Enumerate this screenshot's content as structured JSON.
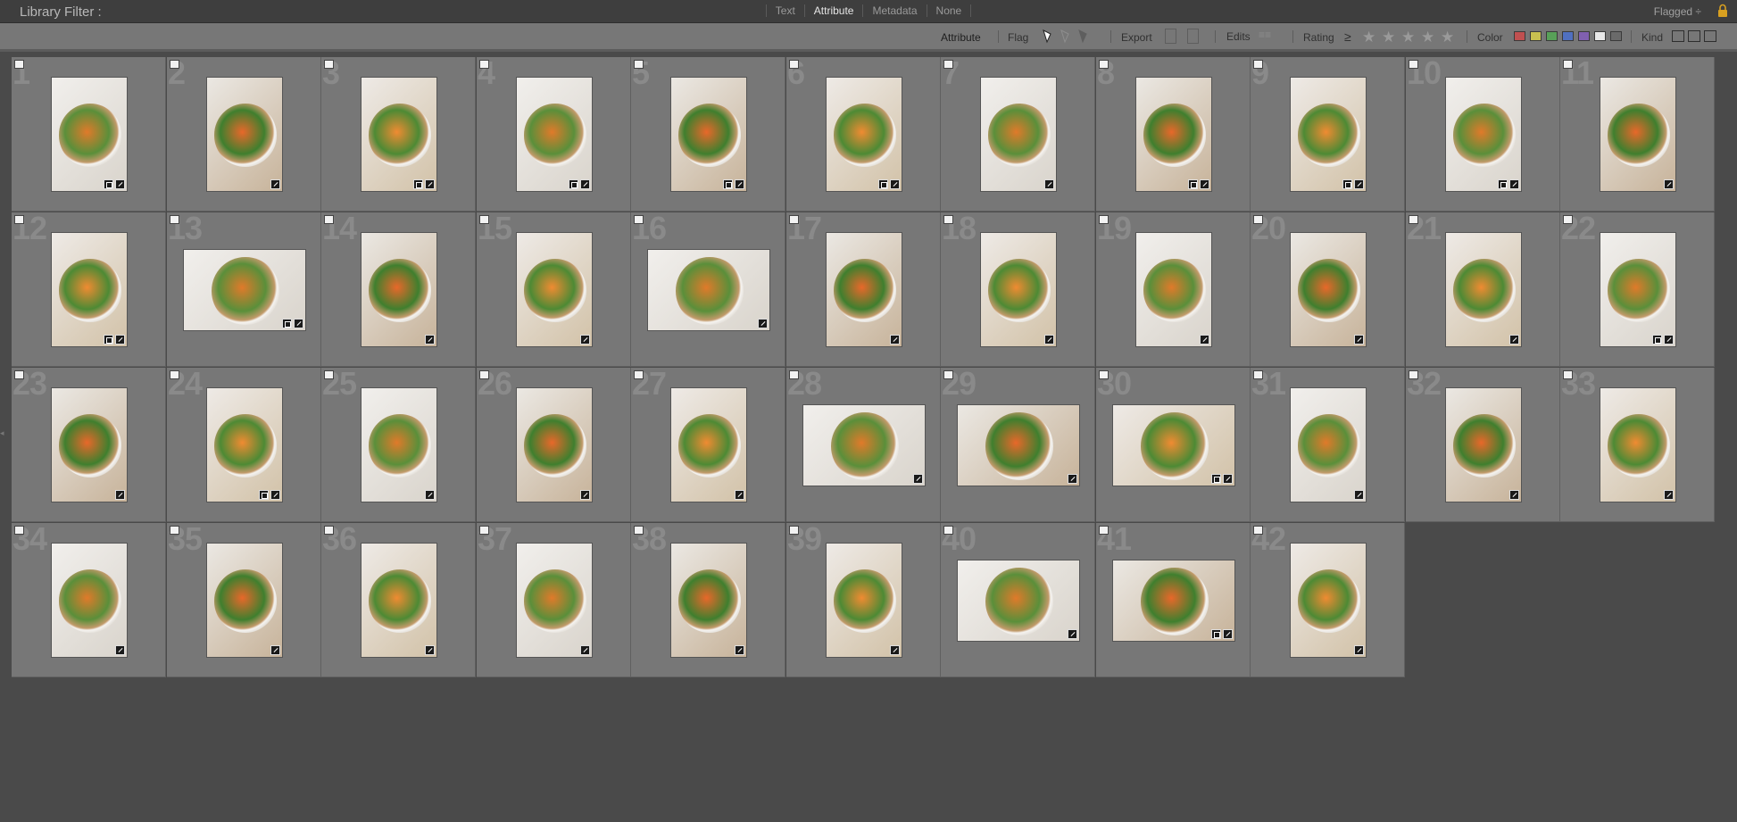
{
  "filter_bar": {
    "title": "Library Filter :",
    "tabs": [
      "Text",
      "Attribute",
      "Metadata",
      "None"
    ],
    "active_tab": "Attribute",
    "preset": "Flagged ÷",
    "lock_icon": "lock-icon"
  },
  "attribute_bar": {
    "label": "Attribute",
    "flag_label": "Flag",
    "export_label": "Export",
    "edits_label": "Edits",
    "rating_label": "Rating",
    "rating_op": "≥",
    "color_label": "Color",
    "kind_label": "Kind",
    "color_swatches": [
      "#c05050",
      "#c8c050",
      "#58a058",
      "#5070c0",
      "#8060b0",
      "#e8e8e8",
      "#6a6a6a"
    ]
  },
  "photos": [
    {
      "n": "1",
      "o": "p",
      "b": 2
    },
    {
      "n": "2",
      "o": "p",
      "b": 1
    },
    {
      "n": "3",
      "o": "p",
      "b": 2
    },
    {
      "n": "4",
      "o": "p",
      "b": 2
    },
    {
      "n": "5",
      "o": "p",
      "b": 2
    },
    {
      "n": "6",
      "o": "p",
      "b": 2
    },
    {
      "n": "7",
      "o": "p",
      "b": 1
    },
    {
      "n": "8",
      "o": "p",
      "b": 2
    },
    {
      "n": "9",
      "o": "p",
      "b": 2
    },
    {
      "n": "10",
      "o": "p",
      "b": 2
    },
    {
      "n": "11",
      "o": "p",
      "b": 1
    },
    {
      "n": "12",
      "o": "p",
      "b": 2
    },
    {
      "n": "13",
      "o": "l",
      "b": 2
    },
    {
      "n": "14",
      "o": "p",
      "b": 1
    },
    {
      "n": "15",
      "o": "p",
      "b": 1
    },
    {
      "n": "16",
      "o": "l",
      "b": 1
    },
    {
      "n": "17",
      "o": "p",
      "b": 1
    },
    {
      "n": "18",
      "o": "p",
      "b": 1
    },
    {
      "n": "19",
      "o": "p",
      "b": 1
    },
    {
      "n": "20",
      "o": "p",
      "b": 1
    },
    {
      "n": "21",
      "o": "p",
      "b": 1
    },
    {
      "n": "22",
      "o": "p",
      "b": 2
    },
    {
      "n": "23",
      "o": "p",
      "b": 1
    },
    {
      "n": "24",
      "o": "p",
      "b": 2
    },
    {
      "n": "25",
      "o": "p",
      "b": 1
    },
    {
      "n": "26",
      "o": "p",
      "b": 1
    },
    {
      "n": "27",
      "o": "p",
      "b": 1
    },
    {
      "n": "28",
      "o": "l",
      "b": 1
    },
    {
      "n": "29",
      "o": "l",
      "b": 1
    },
    {
      "n": "30",
      "o": "l",
      "b": 2
    },
    {
      "n": "31",
      "o": "p",
      "b": 1
    },
    {
      "n": "32",
      "o": "p",
      "b": 1
    },
    {
      "n": "33",
      "o": "p",
      "b": 1
    },
    {
      "n": "34",
      "o": "p",
      "b": 1
    },
    {
      "n": "35",
      "o": "p",
      "b": 1
    },
    {
      "n": "36",
      "o": "p",
      "b": 1
    },
    {
      "n": "37",
      "o": "p",
      "b": 1
    },
    {
      "n": "38",
      "o": "p",
      "b": 1
    },
    {
      "n": "39",
      "o": "p",
      "b": 1
    },
    {
      "n": "40",
      "o": "l",
      "b": 1
    },
    {
      "n": "41",
      "o": "l",
      "b": 2
    },
    {
      "n": "42",
      "o": "p",
      "b": 1
    }
  ]
}
